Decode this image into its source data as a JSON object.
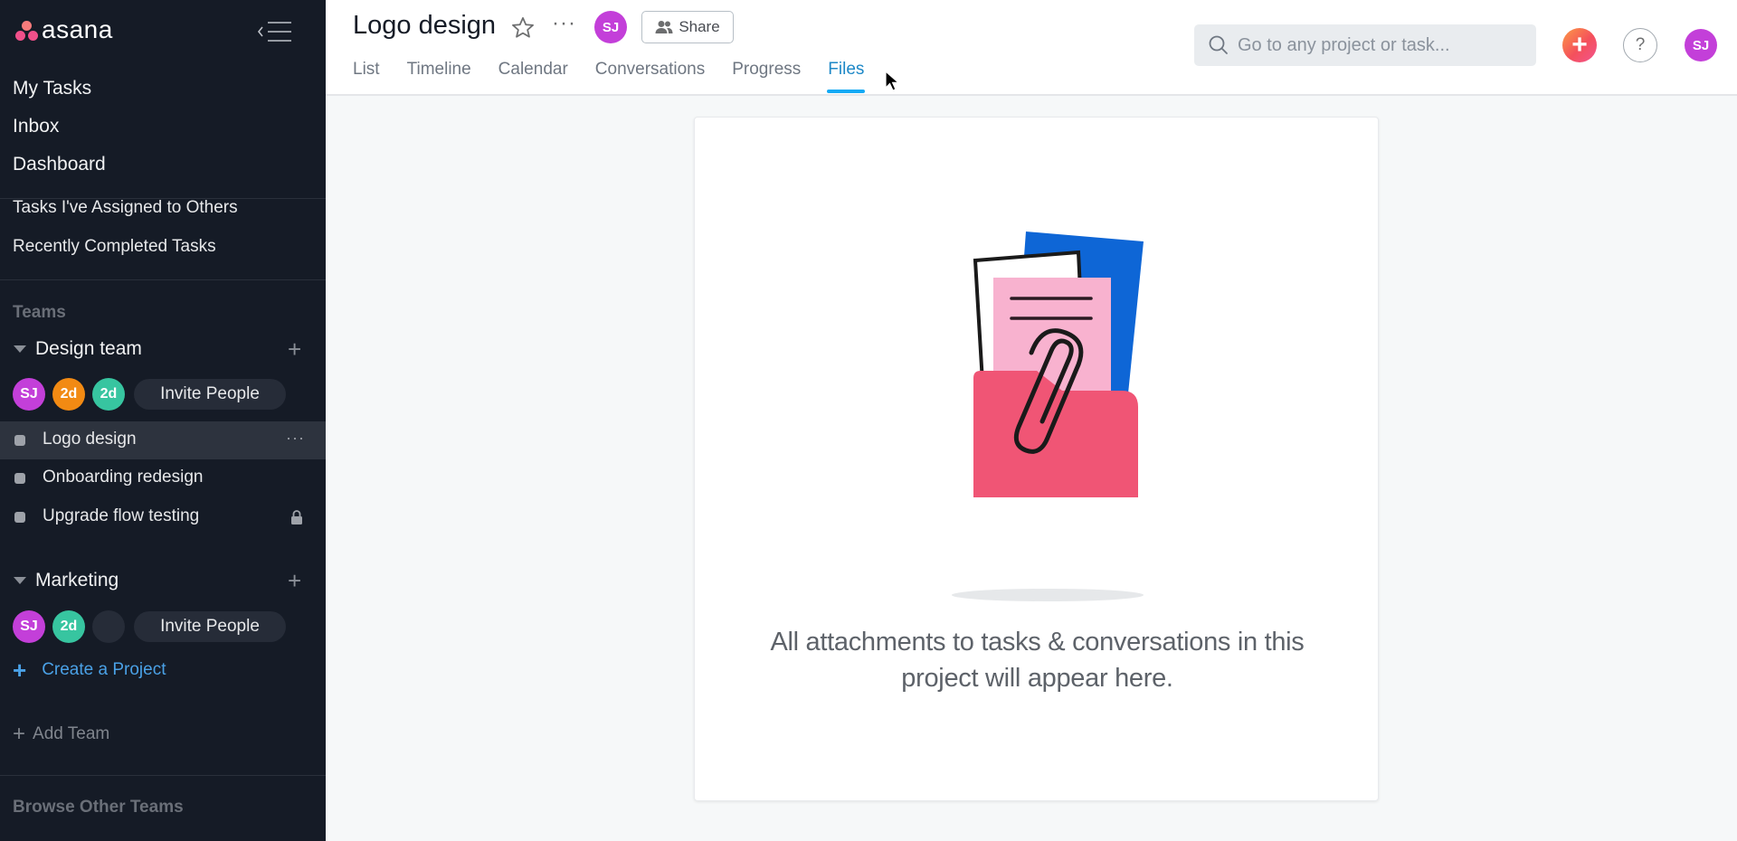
{
  "app": {
    "brand": "asana",
    "colors": {
      "sidebar_bg": "#151b26",
      "accent_blue": "#1e88c7",
      "tab_underline": "#14aaf5",
      "link_blue": "#4aa1e6",
      "quick_add_gradient": [
        "#fc9a45",
        "#f4505c",
        "#f25590"
      ],
      "avatar_sj": "#c33fd9",
      "avatar_orange": "#f28a13",
      "avatar_green": "#37c5a0"
    }
  },
  "sidebar": {
    "collapse_icon": "collapse-sidebar-icon",
    "primary_nav": [
      {
        "label": "My Tasks"
      },
      {
        "label": "Inbox"
      },
      {
        "label": "Dashboard"
      }
    ],
    "secondary_nav": [
      {
        "label": "Tasks I've Assigned to Others"
      },
      {
        "label": "Recently Completed Tasks"
      }
    ],
    "teams_label": "Teams",
    "teams": [
      {
        "name": "Design team",
        "members": [
          {
            "initials": "SJ",
            "color": "#c33fd9"
          },
          {
            "initials": "2d",
            "color": "#f28a13"
          },
          {
            "initials": "2d",
            "color": "#37c5a0"
          }
        ],
        "invite_label": "Invite People",
        "projects": [
          {
            "name": "Logo design",
            "active": true,
            "more": "···"
          },
          {
            "name": "Onboarding redesign",
            "active": false
          },
          {
            "name": "Upgrade flow testing",
            "active": false,
            "locked": true
          }
        ]
      },
      {
        "name": "Marketing",
        "members": [
          {
            "initials": "SJ",
            "color": "#c33fd9"
          },
          {
            "initials": "2d",
            "color": "#37c5a0"
          },
          {
            "initials": "",
            "color": "#262c38"
          }
        ],
        "invite_label": "Invite People",
        "projects": []
      }
    ],
    "create_project_label": "Create a Project",
    "add_team_label": "Add Team",
    "browse_teams_label": "Browse Other Teams"
  },
  "header": {
    "project_title": "Logo design",
    "more_label": "···",
    "owner_initials": "SJ",
    "share_label": "Share",
    "tabs": [
      {
        "label": "List",
        "active": false
      },
      {
        "label": "Timeline",
        "active": false
      },
      {
        "label": "Calendar",
        "active": false
      },
      {
        "label": "Conversations",
        "active": false
      },
      {
        "label": "Progress",
        "active": false
      },
      {
        "label": "Files",
        "active": true
      }
    ],
    "search": {
      "placeholder": "Go to any project or task...",
      "value": ""
    },
    "quick_add_label": "+",
    "help_label": "?",
    "user_initials": "SJ"
  },
  "main": {
    "empty_state": {
      "illustration": "folder-with-attachments-illustration",
      "message": "All attachments to tasks & conversations in this project will appear here."
    }
  }
}
